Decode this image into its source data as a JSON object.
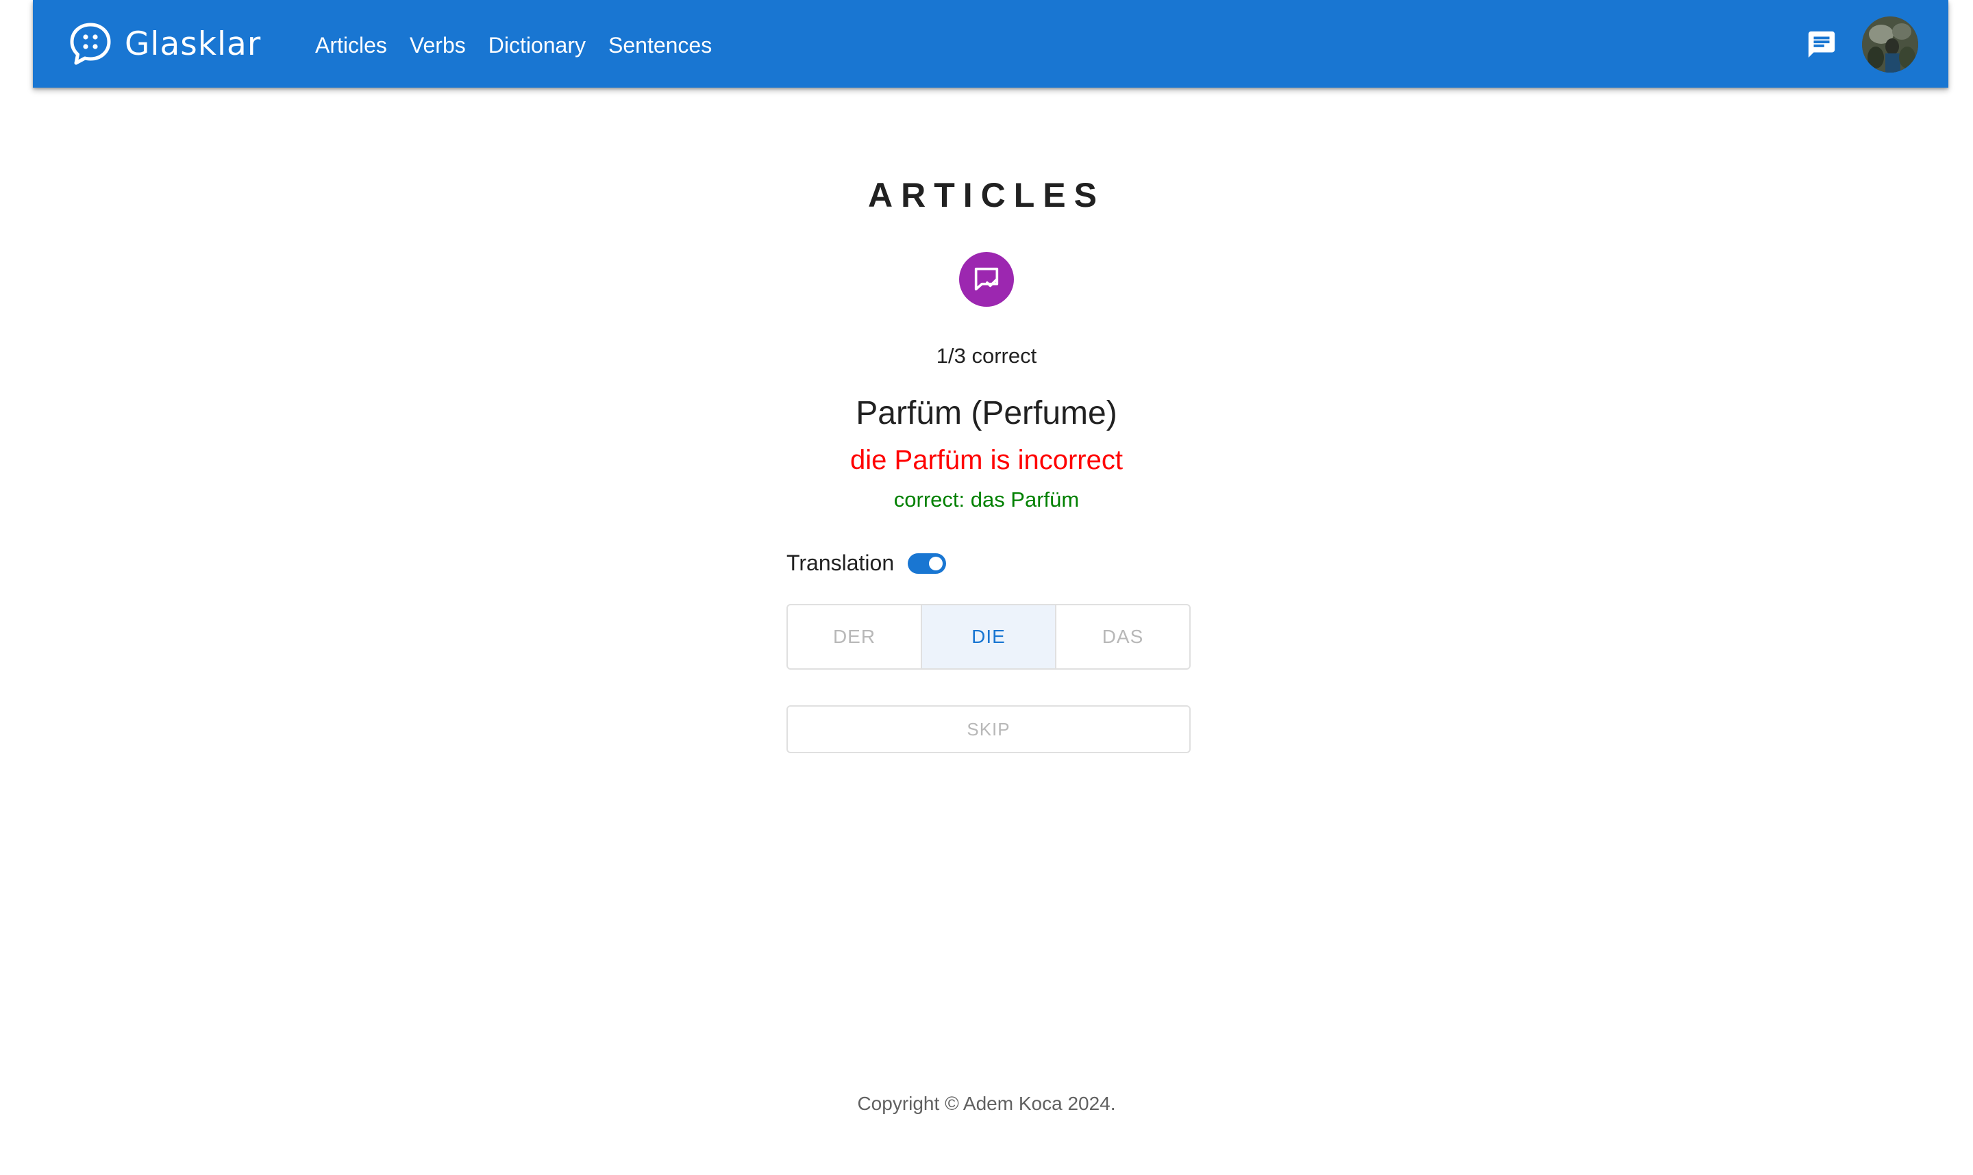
{
  "header": {
    "brand": "Glasklar",
    "nav": [
      "Articles",
      "Verbs",
      "Dictionary",
      "Sentences"
    ],
    "icons": {
      "brand": "chat-dots-icon",
      "messages": "message-icon"
    },
    "colors": {
      "appbar": "#1976d2"
    }
  },
  "quiz": {
    "title": "ARTICLES",
    "badge_icon": "message-check-icon",
    "badge_color": "#9c27b0",
    "score": "1/3 correct",
    "word": "Parfüm (Perfume)",
    "wrong_feedback": "die Parfüm is incorrect",
    "correct_feedback": "correct: das Parfüm",
    "translation_label": "Translation",
    "translation_on": true,
    "choices": [
      "DER",
      "DIE",
      "DAS"
    ],
    "selected_choice": "DIE",
    "skip_label": "SKIP",
    "colors": {
      "wrong": "#ff0000",
      "correct": "#008000"
    }
  },
  "footer": {
    "copyright": "Copyright © Adem Koca 2024."
  }
}
